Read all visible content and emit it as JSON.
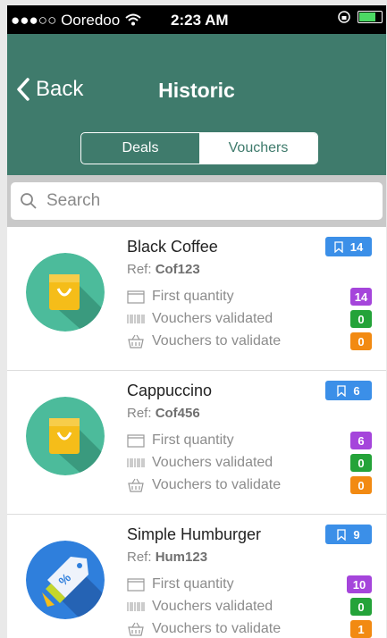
{
  "status": {
    "carrier": "●●●○○ Ooredoo",
    "time": "2:23 AM"
  },
  "header": {
    "back_label": "Back",
    "title": "Historic"
  },
  "segments": {
    "deals": "Deals",
    "vouchers": "Vouchers",
    "active": "vouchers"
  },
  "search": {
    "placeholder": "Search"
  },
  "labels": {
    "ref_prefix": "Ref: ",
    "first_quantity": "First quantity",
    "vouchers_validated": "Vouchers validated",
    "vouchers_to_validate": "Vouchers to validate"
  },
  "items": [
    {
      "name": "Black Coffee",
      "ref": "Cof123",
      "count": "14",
      "first_quantity": "14",
      "validated": "0",
      "to_validate": "0",
      "icon": "shopping-bag-icon"
    },
    {
      "name": "Cappuccino",
      "ref": "Cof456",
      "count": "6",
      "first_quantity": "6",
      "validated": "0",
      "to_validate": "0",
      "icon": "shopping-bag-icon"
    },
    {
      "name": "Simple Humburger",
      "ref": "Hum123",
      "count": "9",
      "first_quantity": "10",
      "validated": "0",
      "to_validate": "1",
      "icon": "discount-tag-icon"
    }
  ],
  "colors": {
    "header": "#3f7b6c",
    "count_badge": "#3b8fe8",
    "first_quantity": "#a545db",
    "validated": "#24a339",
    "to_validate": "#f28a12"
  }
}
